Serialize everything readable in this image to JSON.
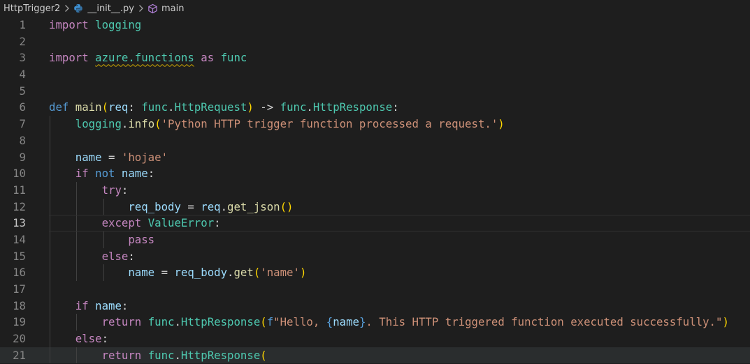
{
  "breadcrumb": {
    "folder": "HttpTrigger2",
    "file": "__init__.py",
    "symbol": "main",
    "separator": ">"
  },
  "colors": {
    "background": "#1e1e1e",
    "keyword": "#c586c0",
    "storage": "#569cd6",
    "type": "#4ec9b0",
    "function": "#dcdcaa",
    "variable": "#9cdcfe",
    "string": "#ce9178",
    "bracket_level1": "#ffd700",
    "bracket_level2": "#da70d6",
    "line_number": "#858585",
    "python_icon": "#3d8fd1",
    "symbol_icon": "#b180d7",
    "warning_squiggle": "#cca700"
  },
  "current_line": 13,
  "code": {
    "lines": [
      {
        "num": "1",
        "tokens": [
          [
            "kw",
            "import"
          ],
          [
            "op",
            " "
          ],
          [
            "mod",
            "logging"
          ]
        ]
      },
      {
        "num": "2",
        "tokens": []
      },
      {
        "num": "3",
        "tokens": [
          [
            "kw",
            "import"
          ],
          [
            "op",
            " "
          ],
          [
            "mod-squig",
            "azure.functions"
          ],
          [
            "op",
            " "
          ],
          [
            "kw",
            "as"
          ],
          [
            "op",
            " "
          ],
          [
            "mod",
            "func"
          ]
        ]
      },
      {
        "num": "4",
        "tokens": []
      },
      {
        "num": "5",
        "tokens": []
      },
      {
        "num": "6",
        "tokens": [
          [
            "def",
            "def"
          ],
          [
            "op",
            " "
          ],
          [
            "fn",
            "main"
          ],
          [
            "b1",
            "("
          ],
          [
            "var",
            "req"
          ],
          [
            "op",
            ": "
          ],
          [
            "mod",
            "func"
          ],
          [
            "op",
            "."
          ],
          [
            "cls",
            "HttpRequest"
          ],
          [
            "b1",
            ")"
          ],
          [
            "op",
            " -> "
          ],
          [
            "mod",
            "func"
          ],
          [
            "op",
            "."
          ],
          [
            "cls",
            "HttpResponse"
          ],
          [
            "op",
            ":"
          ]
        ]
      },
      {
        "num": "7",
        "tokens": [
          [
            "op",
            "    "
          ],
          [
            "mod",
            "logging"
          ],
          [
            "op",
            "."
          ],
          [
            "fn",
            "info"
          ],
          [
            "b1",
            "("
          ],
          [
            "str",
            "'Python HTTP trigger function processed a request.'"
          ],
          [
            "b1",
            ")"
          ]
        ]
      },
      {
        "num": "8",
        "tokens": []
      },
      {
        "num": "9",
        "tokens": [
          [
            "op",
            "    "
          ],
          [
            "var",
            "name"
          ],
          [
            "op",
            " = "
          ],
          [
            "str",
            "'hojae'"
          ]
        ]
      },
      {
        "num": "10",
        "tokens": [
          [
            "op",
            "    "
          ],
          [
            "kw",
            "if"
          ],
          [
            "op",
            " "
          ],
          [
            "def",
            "not"
          ],
          [
            "op",
            " "
          ],
          [
            "var",
            "name"
          ],
          [
            "op",
            ":"
          ]
        ]
      },
      {
        "num": "11",
        "tokens": [
          [
            "op",
            "        "
          ],
          [
            "kw",
            "try"
          ],
          [
            "op",
            ":"
          ]
        ]
      },
      {
        "num": "12",
        "tokens": [
          [
            "op",
            "            "
          ],
          [
            "var",
            "req_body"
          ],
          [
            "op",
            " = "
          ],
          [
            "var",
            "req"
          ],
          [
            "op",
            "."
          ],
          [
            "fn",
            "get_json"
          ],
          [
            "b1",
            "()"
          ]
        ]
      },
      {
        "num": "13",
        "tokens": [
          [
            "op",
            "        "
          ],
          [
            "kw",
            "except"
          ],
          [
            "op",
            " "
          ],
          [
            "cls",
            "ValueError"
          ],
          [
            "op",
            ":"
          ]
        ]
      },
      {
        "num": "14",
        "tokens": [
          [
            "op",
            "            "
          ],
          [
            "kw",
            "pass"
          ]
        ]
      },
      {
        "num": "15",
        "tokens": [
          [
            "op",
            "        "
          ],
          [
            "kw",
            "else"
          ],
          [
            "op",
            ":"
          ]
        ]
      },
      {
        "num": "16",
        "tokens": [
          [
            "op",
            "            "
          ],
          [
            "var",
            "name"
          ],
          [
            "op",
            " = "
          ],
          [
            "var",
            "req_body"
          ],
          [
            "op",
            "."
          ],
          [
            "fn",
            "get"
          ],
          [
            "b1",
            "("
          ],
          [
            "str",
            "'name'"
          ],
          [
            "b1",
            ")"
          ]
        ]
      },
      {
        "num": "17",
        "tokens": []
      },
      {
        "num": "18",
        "tokens": [
          [
            "op",
            "    "
          ],
          [
            "kw",
            "if"
          ],
          [
            "op",
            " "
          ],
          [
            "var",
            "name"
          ],
          [
            "op",
            ":"
          ]
        ]
      },
      {
        "num": "19",
        "tokens": [
          [
            "op",
            "        "
          ],
          [
            "kw",
            "return"
          ],
          [
            "op",
            " "
          ],
          [
            "mod",
            "func"
          ],
          [
            "op",
            "."
          ],
          [
            "cls",
            "HttpResponse"
          ],
          [
            "b1",
            "("
          ],
          [
            "fpre",
            "f"
          ],
          [
            "str",
            "\"Hello, "
          ],
          [
            "def",
            "{"
          ],
          [
            "var",
            "name"
          ],
          [
            "def",
            "}"
          ],
          [
            "str",
            ". This HTTP triggered function executed successfully.\""
          ],
          [
            "b1",
            ")"
          ]
        ]
      },
      {
        "num": "20",
        "tokens": [
          [
            "op",
            "    "
          ],
          [
            "kw",
            "else"
          ],
          [
            "op",
            ":"
          ]
        ]
      },
      {
        "num": "21",
        "tokens": [
          [
            "op",
            "        "
          ],
          [
            "kw",
            "return"
          ],
          [
            "op",
            " "
          ],
          [
            "mod",
            "func"
          ],
          [
            "op",
            "."
          ],
          [
            "cls",
            "HttpResponse"
          ],
          [
            "b1",
            "("
          ]
        ]
      }
    ]
  }
}
